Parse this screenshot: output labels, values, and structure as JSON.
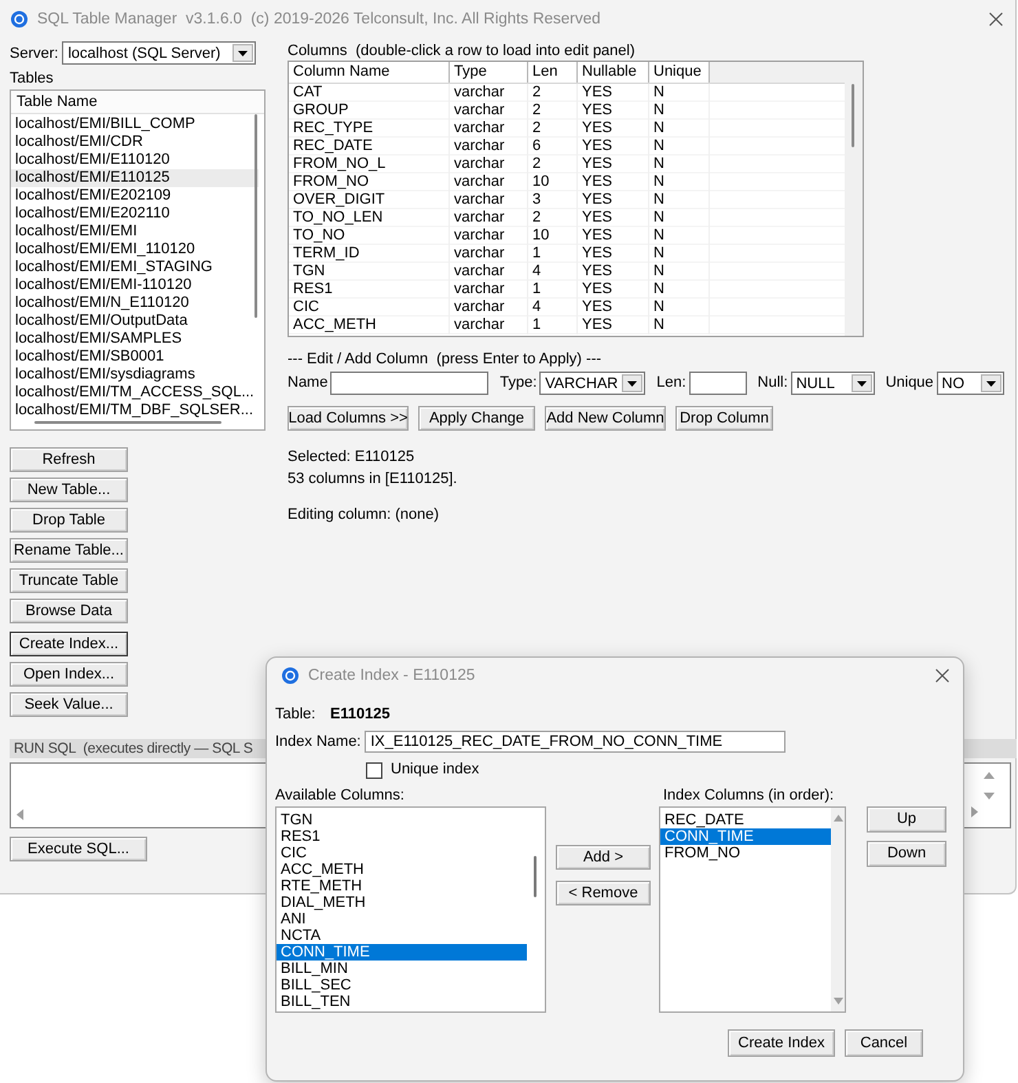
{
  "window": {
    "title": "SQL Table Manager  v3.1.6.0  (c) 2019-2026 Telconsult, Inc. All Rights Reserved"
  },
  "server": {
    "label": "Server:",
    "value": "localhost (SQL Server)"
  },
  "tables": {
    "label": "Tables",
    "header": "Table Name",
    "rows": [
      {
        "name": "localhost/EMI/BILL_COMP",
        "selected": false
      },
      {
        "name": "localhost/EMI/CDR",
        "selected": false
      },
      {
        "name": "localhost/EMI/E110120",
        "selected": false
      },
      {
        "name": "localhost/EMI/E110125",
        "selected": true
      },
      {
        "name": "localhost/EMI/E202109",
        "selected": false
      },
      {
        "name": "localhost/EMI/E202110",
        "selected": false
      },
      {
        "name": "localhost/EMI/EMI",
        "selected": false
      },
      {
        "name": "localhost/EMI/EMI_110120",
        "selected": false
      },
      {
        "name": "localhost/EMI/EMI_STAGING",
        "selected": false
      },
      {
        "name": "localhost/EMI/EMI-110120",
        "selected": false
      },
      {
        "name": "localhost/EMI/N_E110120",
        "selected": false
      },
      {
        "name": "localhost/EMI/OutputData",
        "selected": false
      },
      {
        "name": "localhost/EMI/SAMPLES",
        "selected": false
      },
      {
        "name": "localhost/EMI/SB0001",
        "selected": false
      },
      {
        "name": "localhost/EMI/sysdiagrams",
        "selected": false
      },
      {
        "name": "localhost/EMI/TM_ACCESS_SQL...",
        "selected": false
      },
      {
        "name": "localhost/EMI/TM_DBF_SQLSER...",
        "selected": false
      }
    ]
  },
  "table_buttons": [
    {
      "label": "Refresh",
      "focused": false
    },
    {
      "label": "New Table...",
      "focused": false
    },
    {
      "label": "Drop Table",
      "focused": false
    },
    {
      "label": "Rename Table...",
      "focused": false
    },
    {
      "label": "Truncate Table",
      "focused": false
    },
    {
      "label": "Browse Data",
      "focused": false
    },
    {
      "label": "Create Index...",
      "focused": true
    },
    {
      "label": "Open Index...",
      "focused": false
    },
    {
      "label": "Seek Value...",
      "focused": false
    }
  ],
  "columns": {
    "title": "Columns  (double-click a row to load into edit panel)",
    "headers": [
      "Column Name",
      "Type",
      "Len",
      "Nullable",
      "Unique"
    ],
    "rows": [
      [
        "CAT",
        "varchar",
        "2",
        "YES",
        "N"
      ],
      [
        "GROUP",
        "varchar",
        "2",
        "YES",
        "N"
      ],
      [
        "REC_TYPE",
        "varchar",
        "2",
        "YES",
        "N"
      ],
      [
        "REC_DATE",
        "varchar",
        "6",
        "YES",
        "N"
      ],
      [
        "FROM_NO_L",
        "varchar",
        "2",
        "YES",
        "N"
      ],
      [
        "FROM_NO",
        "varchar",
        "10",
        "YES",
        "N"
      ],
      [
        "OVER_DIGIT",
        "varchar",
        "3",
        "YES",
        "N"
      ],
      [
        "TO_NO_LEN",
        "varchar",
        "2",
        "YES",
        "N"
      ],
      [
        "TO_NO",
        "varchar",
        "10",
        "YES",
        "N"
      ],
      [
        "TERM_ID",
        "varchar",
        "1",
        "YES",
        "N"
      ],
      [
        "TGN",
        "varchar",
        "4",
        "YES",
        "N"
      ],
      [
        "RES1",
        "varchar",
        "1",
        "YES",
        "N"
      ],
      [
        "CIC",
        "varchar",
        "4",
        "YES",
        "N"
      ],
      [
        "ACC_METH",
        "varchar",
        "1",
        "YES",
        "N"
      ]
    ]
  },
  "edit": {
    "title": "--- Edit / Add Column  (press Enter to Apply) ---",
    "fields": [
      {
        "kind": "text",
        "label": "Name"
      },
      {
        "kind": "select",
        "label": "Type:",
        "value": "VARCHAR"
      },
      {
        "kind": "text",
        "label": "Len:"
      },
      {
        "kind": "select",
        "label": "Null:",
        "value": "NULL"
      },
      {
        "kind": "select",
        "label": "Unique",
        "value": "NO"
      }
    ],
    "buttons": [
      "Load Columns >>",
      "Apply Change",
      "Add New Column",
      "Drop Column"
    ]
  },
  "status": {
    "lines": [
      "Selected: E110125",
      "53 columns in [E110125]."
    ],
    "editing": "Editing column: (none)"
  },
  "run_sql": {
    "label": "RUN SQL  (executes directly — SQL S",
    "execute_button": "Execute SQL..."
  },
  "dialog": {
    "title": "Create Index - E110125",
    "table_label": "Table:",
    "table": "E110125",
    "index_name_label": "Index Name:",
    "index_name": "IX_E110125_REC_DATE_FROM_NO_CONN_TIME",
    "unique": {
      "label": "Unique index",
      "checked": false
    },
    "available": {
      "label": "Available Columns:",
      "items": [
        {
          "name": "TGN",
          "selected": false
        },
        {
          "name": "RES1",
          "selected": false
        },
        {
          "name": "CIC",
          "selected": false
        },
        {
          "name": "ACC_METH",
          "selected": false
        },
        {
          "name": "RTE_METH",
          "selected": false
        },
        {
          "name": "DIAL_METH",
          "selected": false
        },
        {
          "name": "ANI",
          "selected": false
        },
        {
          "name": "NCTA",
          "selected": false
        },
        {
          "name": "CONN_TIME",
          "selected": true
        },
        {
          "name": "BILL_MIN",
          "selected": false
        },
        {
          "name": "BILL_SEC",
          "selected": false
        },
        {
          "name": "BILL_TEN",
          "selected": false
        }
      ]
    },
    "index_columns": {
      "label": "Index Columns (in order):",
      "items": [
        {
          "name": "REC_DATE",
          "selected": false
        },
        {
          "name": "CONN_TIME",
          "selected": true
        },
        {
          "name": "FROM_NO",
          "selected": false
        }
      ]
    },
    "move_buttons": [
      "Add >",
      "< Remove"
    ],
    "order_buttons": [
      "Up",
      "Down"
    ],
    "footer_buttons": [
      "Create Index",
      "Cancel"
    ]
  }
}
